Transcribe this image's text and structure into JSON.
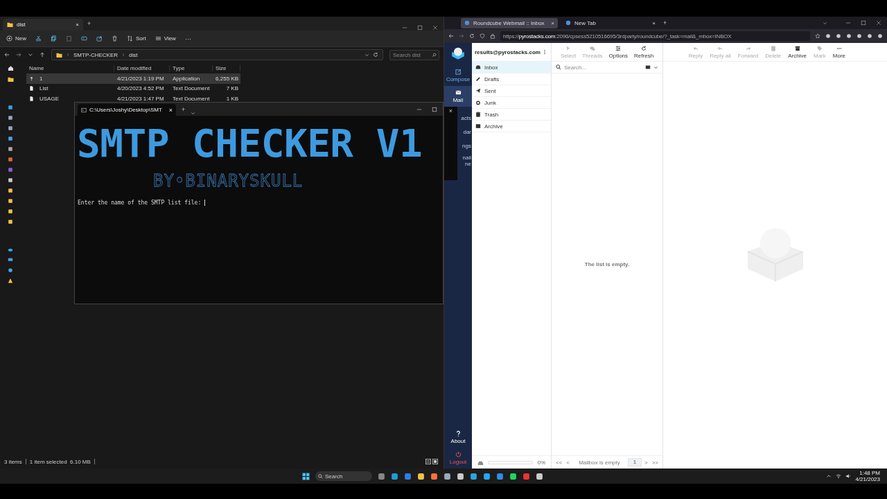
{
  "explorer": {
    "tab_title": "dist",
    "tab_close": "×",
    "new_tab": "+",
    "commands": [
      "New",
      "Sort",
      "View"
    ],
    "more": "···",
    "breadcrumb": [
      "SMTP-CHECKER",
      "dist"
    ],
    "search": {
      "placeholder": "Search dist"
    },
    "columns": [
      "Name",
      "Date modified",
      "Type",
      "Size"
    ],
    "files": [
      {
        "name": "1",
        "date": "4/21/2023 1:19 PM",
        "type": "Application",
        "size": "6,255 KB",
        "kind": "app",
        "selected": true
      },
      {
        "name": "List",
        "date": "4/20/2023 4:52 PM",
        "type": "Text Document",
        "size": "7 KB",
        "kind": "doc",
        "selected": false
      },
      {
        "name": "USAGE",
        "date": "4/21/2023 1:47 PM",
        "type": "Text Document",
        "size": "1 KB",
        "kind": "doc",
        "selected": false
      }
    ],
    "status": [
      "3 items",
      "1 item selected  6.10 MB"
    ]
  },
  "terminal": {
    "tab_title": "C:\\Users\\Joshy\\Desktop\\SMT",
    "tab_close": "×",
    "new_tab": "+",
    "banner": "SMTP CHECKER V1",
    "byline": "BY•BINARYSKULL",
    "prompt": "Enter the name of the SMTP list file: "
  },
  "browser": {
    "tabs": [
      {
        "title": "Roundcube Webmail :: Inbox",
        "selected": true
      },
      {
        "title": "New Tab",
        "selected": false
      }
    ],
    "tab_close": "×",
    "new_tab": "+",
    "url": {
      "scheme": "https://",
      "host": "pyrostacks.com",
      "rest": ":2096/cpsess5210516695/3rdparty/roundcube/?_task=mail&_mbox=INBOX"
    }
  },
  "roundcube": {
    "nav": [
      {
        "label": "Compose",
        "selected": false
      },
      {
        "label": "Mail",
        "selected": true
      }
    ],
    "partial_nav": [
      "acts",
      "dar",
      "ngs",
      "nail",
      "ne"
    ],
    "overlay_close": "×",
    "bottom_nav": [
      "About",
      "Logout"
    ],
    "account": "results@pyrostacks.com",
    "folders": [
      {
        "name": "Inbox",
        "selected": true
      },
      {
        "name": "Drafts",
        "selected": false
      },
      {
        "name": "Sent",
        "selected": false
      },
      {
        "name": "Junk",
        "selected": false
      },
      {
        "name": "Trash",
        "selected": false
      },
      {
        "name": "Archive",
        "selected": false
      }
    ],
    "quota": "0%",
    "list_toolbar": [
      {
        "label": "Select",
        "disabled": true
      },
      {
        "label": "Threads",
        "disabled": true
      },
      {
        "label": "Options",
        "disabled": false
      },
      {
        "label": "Refresh",
        "disabled": false
      }
    ],
    "search": {
      "placeholder": "Search..."
    },
    "empty": "The list is empty.",
    "pager": {
      "first": "<<",
      "prev": "<",
      "count": "Mailbox is empty",
      "page": "1",
      "next": ">",
      "last": ">>"
    },
    "message_toolbar": [
      {
        "label": "Reply",
        "disabled": true
      },
      {
        "label": "Reply all",
        "disabled": true
      },
      {
        "label": "Forward",
        "disabled": true
      },
      {
        "label": "Delete",
        "disabled": true
      },
      {
        "label": "Archive",
        "disabled": false
      },
      {
        "label": "Mark",
        "disabled": true
      },
      {
        "label": "More",
        "disabled": false
      }
    ]
  },
  "taskbar": {
    "search": {
      "placeholder": "Search"
    },
    "time": "1:48 PM",
    "date": "4/21/2023"
  }
}
